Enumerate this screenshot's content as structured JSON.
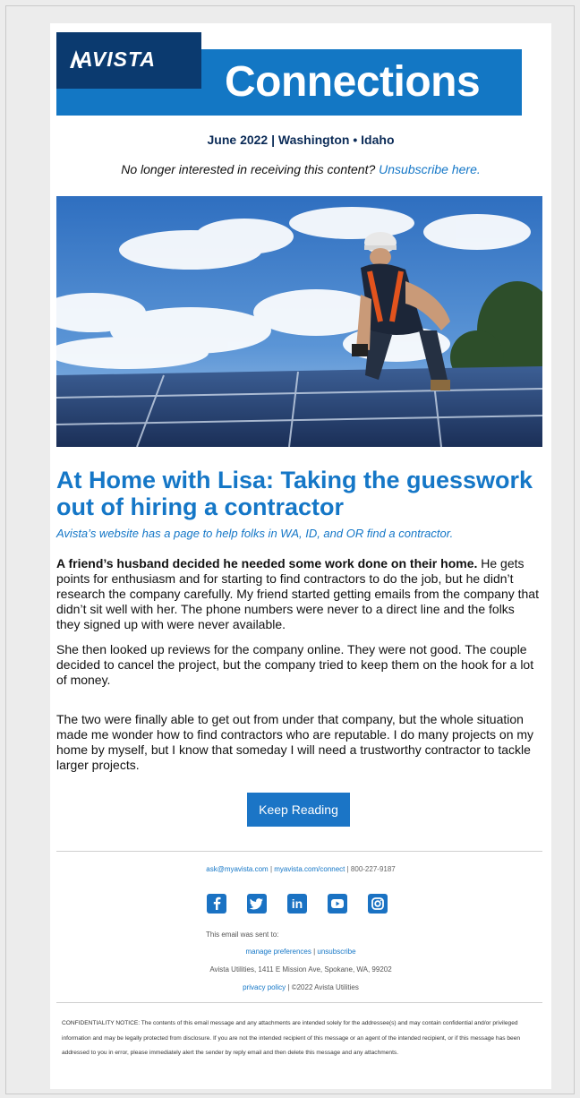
{
  "brand": {
    "logo_text": "AVISTA",
    "newsletter_title": "Connections"
  },
  "edition": "June 2022 | Washington • Idaho",
  "unsubscribe": {
    "prompt": "No longer interested in receiving this content?",
    "link_label": "Unsubscribe here."
  },
  "article": {
    "title": "At Home with Lisa: Taking the guesswork out of hiring a contractor",
    "subtitle": "Avista’s website has a page to help folks in WA, ID, and OR find a contractor.",
    "p1_lead": "A friend’s husband decided he needed some work done on their home.",
    "p1_rest": " He gets points for enthusiasm and for starting to find contractors to do the job, but he didn’t research the company carefully. My friend started getting emails from the company that didn’t sit well with her. The phone numbers were never to a direct line and the folks they signed up with were never available.",
    "p2": "She then looked up reviews for the company online. They were not good. The couple decided to cancel the project, but the company tried to keep them on the hook for a lot of money.",
    "p3": "The two were finally able to get out from under that company, but the whole situation made me wonder how to find contractors who are reputable. I do many projects on my home by myself, but I know that someday I will need a trustworthy contractor to tackle larger projects.",
    "button_label": "Keep Reading"
  },
  "footer": {
    "email": "ask@myavista.com",
    "sep": " | ",
    "web": "myavista.com/connect",
    "phone": "800-227-9187",
    "social_icons": [
      "facebook-icon",
      "twitter-icon",
      "linkedin-icon",
      "youtube-icon",
      "instagram-icon"
    ],
    "sent_to": "This email was sent to:",
    "manage_prefs": "manage preferences",
    "unsubscribe": "unsubscribe",
    "address": "Avista Utilities, 1411 E Mission Ave, Spokane, WA, 99202",
    "privacy": "privacy policy",
    "copyright": "©2022 Avista Utilities",
    "confidential": "CONFIDENTIALITY NOTICE: The contents of this email message and any attachments are intended solely for the addressee(s) and may contain confidential and/or privileged information and may be legally protected from disclosure. If you are not the intended recipient of this message or an agent of the intended recipient, or if this message has been addressed to you in error, please immediately alert the sender by reply email and then delete this message and any attachments."
  },
  "colors": {
    "brand_blue": "#1377c4",
    "navy": "#0b3a6f",
    "link_blue": "#1577c7",
    "button_blue": "#1b75c6"
  }
}
